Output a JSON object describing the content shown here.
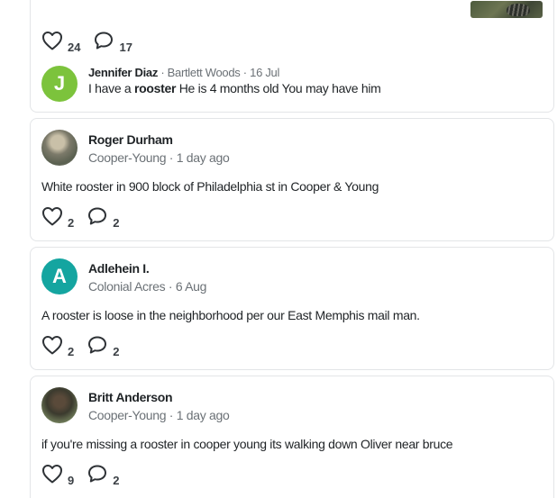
{
  "post0": {
    "likes": "24",
    "comments": "17",
    "reply": {
      "initial": "J",
      "author": "Jennifer Diaz",
      "meta": " · Bartlett Woods · 16 Jul",
      "text_before": "I have a ",
      "text_bold": "rooster",
      "text_after": "  He is 4 months old  You may have him"
    }
  },
  "posts": [
    {
      "author": "Roger Durham",
      "meta": "Cooper-Young · 1 day ago",
      "body": "White rooster in 900 block of Philadelphia st in Cooper & Young",
      "likes": "2",
      "comments": "2"
    },
    {
      "initial": "A",
      "author": "Adlehein I.",
      "meta": "Colonial Acres · 6 Aug",
      "body": "A rooster is loose in the neighborhood per our East Memphis mail man.",
      "likes": "2",
      "comments": "2"
    },
    {
      "author": "Britt Anderson",
      "meta": "Cooper-Young · 1 day ago",
      "body": "if you're missing a rooster in cooper young its walking down Oliver near bruce",
      "likes": "9",
      "comments": "2"
    }
  ],
  "colors": {
    "avatar_green": "#7cc33c",
    "avatar_teal": "#14a5a0",
    "border": "#e3e5e7",
    "meta_text": "#6b7176"
  },
  "icons": [
    "heart-icon",
    "comment-bubble-icon"
  ]
}
